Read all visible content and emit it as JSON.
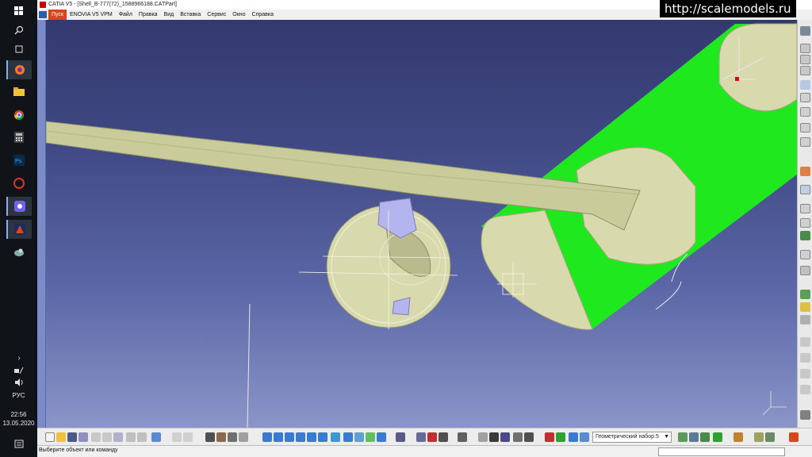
{
  "window": {
    "app_title": "CATIA V5 - [Shell_B-777(72)_1588966188.CATPart]"
  },
  "menu": {
    "items": [
      "Пуск",
      "ENOVIA V5 VPM",
      "Файл",
      "Правка",
      "Вид",
      "Вставка",
      "Сервис",
      "Окно",
      "Справка"
    ]
  },
  "taskbar": {
    "language": "РУС",
    "time": "22:56",
    "date": "13.05.2020",
    "icons": [
      "windows-start-icon",
      "search-icon",
      "task-view-icon",
      "firefox-icon",
      "file-explorer-icon",
      "chrome-icon",
      "calculator-icon",
      "photoshop-icon",
      "opera-icon",
      "viber-icon",
      "catia-icon",
      "app-icon"
    ]
  },
  "toolbar": {
    "geometric_set": "Геометрический набор.5"
  },
  "status": {
    "prompt": "Выберите объект или команду"
  },
  "watermark": {
    "text": "http://scalemodels.ru"
  },
  "colors": {
    "viewport_top": "#343a6f",
    "viewport_bottom": "#8b95c8",
    "model_surface": "#d8d9ac",
    "highlight_green": "#1fe81f",
    "pylon_blue": "#b4b4ee",
    "start_button": "#d8451f"
  }
}
